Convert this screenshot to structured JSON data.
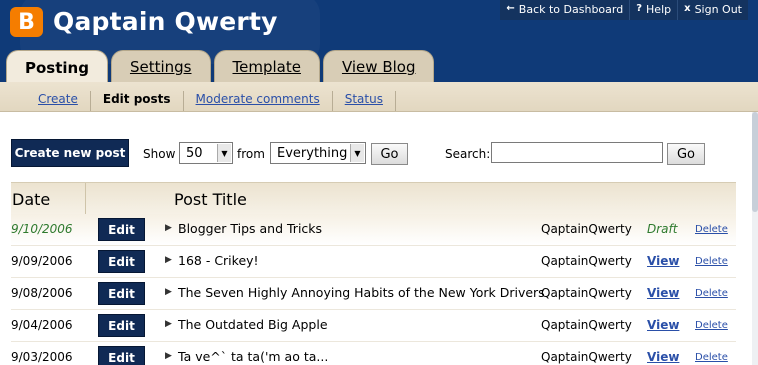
{
  "header": {
    "app_title": "Qaptain Qwerty",
    "logo_letter": "B",
    "brand_color": "#0f3a78",
    "logo_color": "#f57d00",
    "top_links": [
      {
        "icon": "back-arrow-icon",
        "glyph": "←",
        "label": "Back to Dashboard"
      },
      {
        "icon": "help-icon",
        "glyph": "?",
        "label": "Help"
      },
      {
        "icon": "close-icon",
        "glyph": "x",
        "label": "Sign Out"
      }
    ]
  },
  "tabs": [
    {
      "label": "Posting",
      "active": true
    },
    {
      "label": "Settings",
      "active": false
    },
    {
      "label": "Template",
      "active": false
    },
    {
      "label": "View Blog",
      "active": false
    }
  ],
  "subnav": [
    {
      "label": "Create",
      "active": false
    },
    {
      "label": "Edit posts",
      "active": true
    },
    {
      "label": "Moderate comments",
      "active": false
    },
    {
      "label": "Status",
      "active": false
    }
  ],
  "toolbar": {
    "create_label": "Create new post",
    "show_label": "Show",
    "show_value": "50",
    "from_label": "from",
    "filter_value": "Everything",
    "go_label": "Go",
    "search_label": "Search:",
    "search_value": "",
    "search_go_label": "Go"
  },
  "table": {
    "headers": {
      "date": "Date",
      "title": "Post Title"
    },
    "rows": [
      {
        "date": "9/10/2006",
        "title": "Blogger Tips and Tricks",
        "author": "QaptainQwerty",
        "status": "Draft",
        "is_draft": true,
        "edit": "Edit",
        "delete": "Delete"
      },
      {
        "date": "9/09/2006",
        "title": "168 - Crikey!",
        "author": "QaptainQwerty",
        "status": "View",
        "is_draft": false,
        "edit": "Edit",
        "delete": "Delete"
      },
      {
        "date": "9/08/2006",
        "title": "The Seven Highly Annoying Habits of the New York Drivers",
        "author": "QaptainQwerty",
        "status": "View",
        "is_draft": false,
        "edit": "Edit",
        "delete": "Delete"
      },
      {
        "date": "9/04/2006",
        "title": "The Outdated Big Apple",
        "author": "QaptainQwerty",
        "status": "View",
        "is_draft": false,
        "edit": "Edit",
        "delete": "Delete"
      },
      {
        "date": "9/03/2006",
        "title": "Ta ve^` ta ta('m ao ta...",
        "author": "QaptainQwerty",
        "status": "View",
        "is_draft": false,
        "edit": "Edit",
        "delete": "Delete"
      }
    ]
  }
}
